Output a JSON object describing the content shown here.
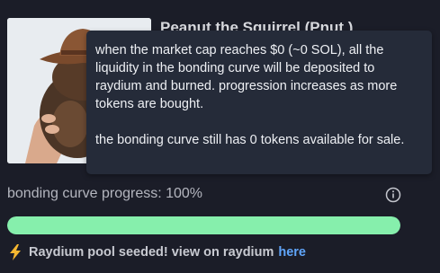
{
  "token": {
    "title": "Peanut the Squirrel (Pnut )",
    "image_icon": "squirrel-photo"
  },
  "tooltip": {
    "paragraph1": "when the market cap reaches $0 (~0 SOL), all the liquidity in the bonding curve will be deposited to raydium and burned. progression increases as more tokens are bought.",
    "paragraph2": "the bonding curve still has 0 tokens available for sale."
  },
  "progress": {
    "label": "bonding curve progress: 100%",
    "percent": 100,
    "fill_color": "#86efac",
    "info_icon": "info-circle-icon"
  },
  "status": {
    "icon": "lightning-bolt-icon",
    "text": "Raydium pool seeded! view on raydium",
    "link": "here",
    "link_color": "#60a5fa"
  }
}
